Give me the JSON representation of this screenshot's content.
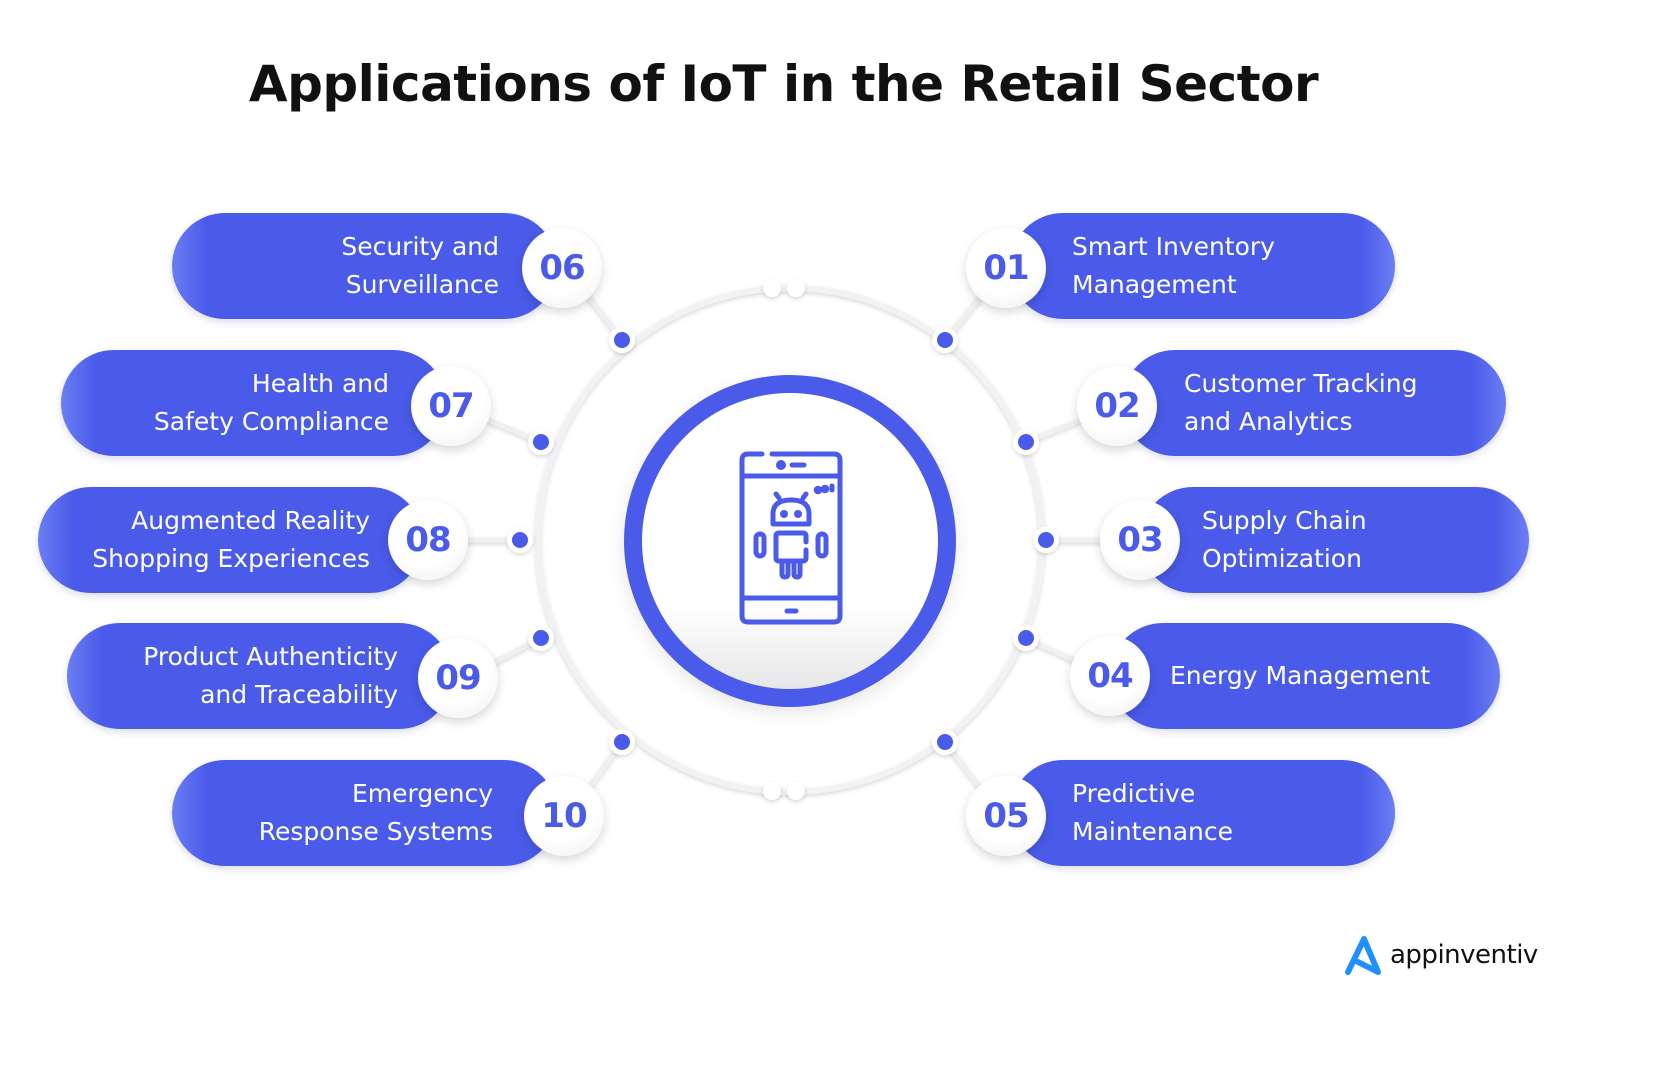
{
  "title": "Applications of IoT in the Retail Sector",
  "colors": {
    "accent": "#4a5be9",
    "accent_light": "#6b7ef3",
    "badge_bg": "#ffffff",
    "title_text": "#111111",
    "logo_blue": "#1e90ff"
  },
  "center": {
    "icon": "android-smartphone-icon"
  },
  "applications": [
    {
      "number": "01",
      "label": "Smart Inventory\nManagement",
      "side": "right"
    },
    {
      "number": "02",
      "label": "Customer Tracking\nand Analytics",
      "side": "right"
    },
    {
      "number": "03",
      "label": "Supply Chain\nOptimization",
      "side": "right"
    },
    {
      "number": "04",
      "label": "Energy Management",
      "side": "right"
    },
    {
      "number": "05",
      "label": "Predictive\nMaintenance",
      "side": "right"
    },
    {
      "number": "06",
      "label": "Security and\nSurveillance",
      "side": "left"
    },
    {
      "number": "07",
      "label": "Health and\nSafety Compliance",
      "side": "left"
    },
    {
      "number": "08",
      "label": "Augmented Reality\nShopping Experiences",
      "side": "left"
    },
    {
      "number": "09",
      "label": "Product Authenticity\nand Traceability",
      "side": "left"
    },
    {
      "number": "10",
      "label": "Emergency\nResponse Systems",
      "side": "left"
    }
  ],
  "logo": {
    "icon": "appinventiv-logo-icon",
    "text": "appinventiv"
  }
}
